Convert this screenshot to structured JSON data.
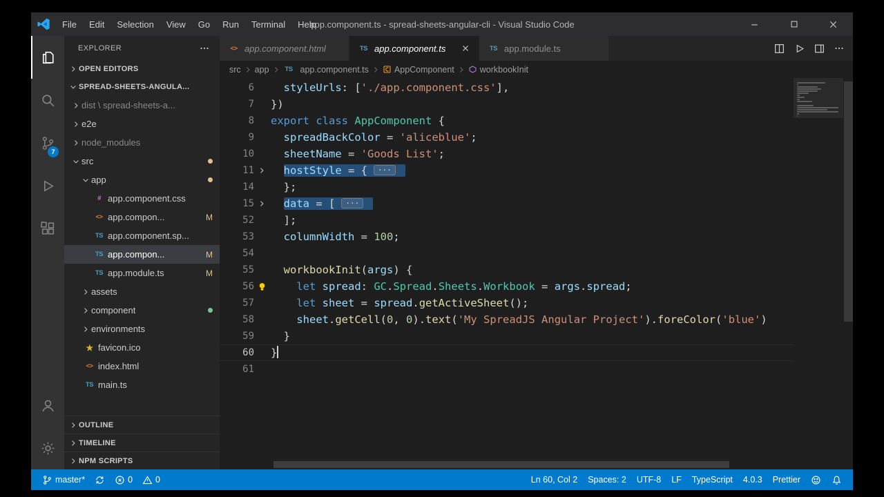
{
  "window": {
    "title": "app.component.ts - spread-sheets-angular-cli - Visual Studio Code",
    "menus": [
      "File",
      "Edit",
      "Selection",
      "View",
      "Go",
      "Run",
      "Terminal",
      "Help"
    ],
    "controls": [
      {
        "id": "minimize",
        "icon": "minimize-icon"
      },
      {
        "id": "maximize",
        "icon": "maximize-icon"
      },
      {
        "id": "close",
        "icon": "close-window-icon"
      }
    ]
  },
  "activity_bar": {
    "items": [
      {
        "id": "explorer",
        "icon": "files-icon",
        "active": true
      },
      {
        "id": "search",
        "icon": "search-icon"
      },
      {
        "id": "source-control",
        "icon": "source-control-icon",
        "badge": "7"
      },
      {
        "id": "run-debug",
        "icon": "run-debug-icon"
      },
      {
        "id": "extensions",
        "icon": "extensions-icon"
      }
    ],
    "bottom_items": [
      {
        "id": "accounts",
        "icon": "accounts-icon"
      },
      {
        "id": "settings",
        "icon": "settings-gear-icon"
      }
    ]
  },
  "sidebar": {
    "title": "EXPLORER",
    "open_editors_label": "OPEN EDITORS",
    "project_label": "SPREAD-SHEETS-ANGULA...",
    "bottom_sections": [
      "OUTLINE",
      "TIMELINE",
      "NPM SCRIPTS"
    ],
    "tree": [
      {
        "label": "dist \\ spread-sheets-a...",
        "indent": 0,
        "kind": "folder",
        "expanded": false,
        "dim": true
      },
      {
        "label": "e2e",
        "indent": 0,
        "kind": "folder",
        "expanded": false
      },
      {
        "label": "node_modules",
        "indent": 0,
        "kind": "folder",
        "expanded": false,
        "dim": true
      },
      {
        "label": "src",
        "indent": 0,
        "kind": "folder",
        "expanded": true,
        "dot": "modified"
      },
      {
        "label": "app",
        "indent": 1,
        "kind": "folder",
        "expanded": true,
        "dot": "modified"
      },
      {
        "label": "app.component.css",
        "indent": 2,
        "kind": "file",
        "icon": "css"
      },
      {
        "label": "app.compon...",
        "indent": 2,
        "kind": "file",
        "icon": "html",
        "badge": "M"
      },
      {
        "label": "app.component.sp...",
        "indent": 2,
        "kind": "file",
        "icon": "ts"
      },
      {
        "label": "app.compon...",
        "indent": 2,
        "kind": "file",
        "icon": "ts",
        "badge": "M",
        "selected": true
      },
      {
        "label": "app.module.ts",
        "indent": 2,
        "kind": "file",
        "icon": "ts",
        "badge": "M"
      },
      {
        "label": "assets",
        "indent": 1,
        "kind": "folder",
        "expanded": false
      },
      {
        "label": "component",
        "indent": 1,
        "kind": "folder",
        "expanded": false,
        "dot": "untracked"
      },
      {
        "label": "environments",
        "indent": 1,
        "kind": "folder",
        "expanded": false
      },
      {
        "label": "favicon.ico",
        "indent": 1,
        "kind": "file",
        "icon": "ico"
      },
      {
        "label": "index.html",
        "indent": 1,
        "kind": "file",
        "icon": "html"
      },
      {
        "label": "main.ts",
        "indent": 1,
        "kind": "file",
        "icon": "ts"
      }
    ]
  },
  "tabs": [
    {
      "label": "app.component.html",
      "file_icon": "html",
      "active": false,
      "italic": true,
      "closable": false
    },
    {
      "label": "app.component.ts",
      "file_icon": "ts",
      "active": true,
      "italic": true,
      "closable": true
    },
    {
      "label": "app.module.ts",
      "file_icon": "ts",
      "active": false,
      "italic": false,
      "closable": false
    }
  ],
  "editor_actions": [
    {
      "id": "split-editor",
      "icon": "split-editor-icon"
    },
    {
      "id": "run",
      "icon": "run-icon"
    },
    {
      "id": "layout",
      "icon": "layout-icon"
    },
    {
      "id": "more-actions",
      "icon": "more-icon"
    }
  ],
  "breadcrumbs": [
    {
      "label": "src"
    },
    {
      "label": "app"
    },
    {
      "label": "app.component.ts",
      "file_icon": "ts"
    },
    {
      "label": "AppComponent",
      "icon": "symbol-class-icon"
    },
    {
      "label": "workbookInit",
      "icon": "symbol-method-icon"
    }
  ],
  "editor": {
    "fold_marker": "···",
    "lines": [
      {
        "num": "6",
        "tokens": [
          [
            "  ",
            "p"
          ],
          [
            "styleUrls",
            "v"
          ],
          [
            ": [",
            "p"
          ],
          [
            "'./app.component.css'",
            "s"
          ],
          [
            "],",
            "p"
          ]
        ]
      },
      {
        "num": "7",
        "tokens": [
          [
            "})",
            "p"
          ]
        ]
      },
      {
        "num": "8",
        "tokens": [
          [
            "export",
            "k"
          ],
          [
            " ",
            "p"
          ],
          [
            "class",
            "k"
          ],
          [
            " ",
            "p"
          ],
          [
            "AppComponent",
            "t"
          ],
          [
            " {",
            "p"
          ]
        ]
      },
      {
        "num": "9",
        "tokens": [
          [
            "  ",
            "p"
          ],
          [
            "spreadBackColor",
            "v"
          ],
          [
            " = ",
            "p"
          ],
          [
            "'aliceblue'",
            "s"
          ],
          [
            ";",
            "p"
          ]
        ]
      },
      {
        "num": "10",
        "tokens": [
          [
            "  ",
            "p"
          ],
          [
            "sheetName",
            "v"
          ],
          [
            " = ",
            "p"
          ],
          [
            "'Goods List'",
            "s"
          ],
          [
            ";",
            "p"
          ]
        ]
      },
      {
        "num": "11",
        "fold": true,
        "sel": true,
        "tokens": [
          [
            "  ",
            "p"
          ],
          [
            "hostStyle",
            "v"
          ],
          [
            " = {",
            "p"
          ]
        ]
      },
      {
        "num": "14",
        "tokens": [
          [
            "  };",
            "p"
          ]
        ]
      },
      {
        "num": "15",
        "fold": true,
        "sel": true,
        "tokens": [
          [
            "  ",
            "p"
          ],
          [
            "data",
            "v"
          ],
          [
            " = [",
            "p"
          ]
        ]
      },
      {
        "num": "52",
        "tokens": [
          [
            "  ];",
            "p"
          ]
        ]
      },
      {
        "num": "53",
        "tokens": [
          [
            "  ",
            "p"
          ],
          [
            "columnWidth",
            "v"
          ],
          [
            " = ",
            "p"
          ],
          [
            "100",
            "n"
          ],
          [
            ";",
            "p"
          ]
        ]
      },
      {
        "num": "54",
        "tokens": []
      },
      {
        "num": "55",
        "tokens": [
          [
            "  ",
            "p"
          ],
          [
            "workbookInit",
            "f"
          ],
          [
            "(",
            "p"
          ],
          [
            "args",
            "v"
          ],
          [
            ") {",
            "p"
          ]
        ]
      },
      {
        "num": "56",
        "bulb": true,
        "tokens": [
          [
            "    ",
            "p"
          ],
          [
            "let",
            "k"
          ],
          [
            " ",
            "p"
          ],
          [
            "spread",
            "v"
          ],
          [
            ": ",
            "p"
          ],
          [
            "GC",
            "t"
          ],
          [
            ".",
            "p"
          ],
          [
            "Spread",
            "t"
          ],
          [
            ".",
            "p"
          ],
          [
            "Sheets",
            "t"
          ],
          [
            ".",
            "p"
          ],
          [
            "Workbook",
            "t"
          ],
          [
            " = ",
            "p"
          ],
          [
            "args",
            "v"
          ],
          [
            ".",
            "p"
          ],
          [
            "spread",
            "v"
          ],
          [
            ";",
            "p"
          ]
        ]
      },
      {
        "num": "57",
        "tokens": [
          [
            "    ",
            "p"
          ],
          [
            "let",
            "k"
          ],
          [
            " ",
            "p"
          ],
          [
            "sheet",
            "v"
          ],
          [
            " = ",
            "p"
          ],
          [
            "spread",
            "v"
          ],
          [
            ".",
            "p"
          ],
          [
            "getActiveSheet",
            "f"
          ],
          [
            "();",
            "p"
          ]
        ]
      },
      {
        "num": "58",
        "tokens": [
          [
            "    ",
            "p"
          ],
          [
            "sheet",
            "v"
          ],
          [
            ".",
            "p"
          ],
          [
            "getCell",
            "f"
          ],
          [
            "(",
            "p"
          ],
          [
            "0",
            "n"
          ],
          [
            ", ",
            "p"
          ],
          [
            "0",
            "n"
          ],
          [
            ").",
            "p"
          ],
          [
            "text",
            "f"
          ],
          [
            "(",
            "p"
          ],
          [
            "'My SpreadJS Angular Project'",
            "s"
          ],
          [
            ").",
            "p"
          ],
          [
            "foreColor",
            "f"
          ],
          [
            "(",
            "p"
          ],
          [
            "'blue'",
            "s"
          ],
          [
            ")",
            "p"
          ]
        ]
      },
      {
        "num": "59",
        "tokens": [
          [
            "  }",
            "p"
          ]
        ]
      },
      {
        "num": "60",
        "current": true,
        "cursor": true,
        "tokens": [
          [
            "}",
            "p"
          ]
        ]
      },
      {
        "num": "61",
        "tokens": []
      }
    ]
  },
  "status_bar": {
    "left": [
      {
        "id": "branch",
        "icon": "branch-icon",
        "label": "master*"
      },
      {
        "id": "sync",
        "icon": "sync-icon",
        "label": ""
      },
      {
        "id": "errors",
        "icon": "error-icon",
        "label": "0"
      },
      {
        "id": "warnings",
        "icon": "warning-icon",
        "label": "0"
      }
    ],
    "right": [
      {
        "id": "cursor-position",
        "label": "Ln 60, Col 2"
      },
      {
        "id": "indentation",
        "label": "Spaces: 2"
      },
      {
        "id": "encoding",
        "label": "UTF-8"
      },
      {
        "id": "eol",
        "label": "LF"
      },
      {
        "id": "language",
        "label": "TypeScript"
      },
      {
        "id": "ts-version",
        "label": "4.0.3"
      },
      {
        "id": "formatter",
        "label": "Prettier"
      },
      {
        "id": "feedback",
        "icon": "feedback-icon"
      },
      {
        "id": "notifications",
        "icon": "bell-icon"
      }
    ]
  },
  "colors": {
    "status_bar": "#007acc",
    "badge": "#007acc",
    "modified": "#e2c08d",
    "untracked": "#73c991",
    "selection": "#264f78"
  }
}
